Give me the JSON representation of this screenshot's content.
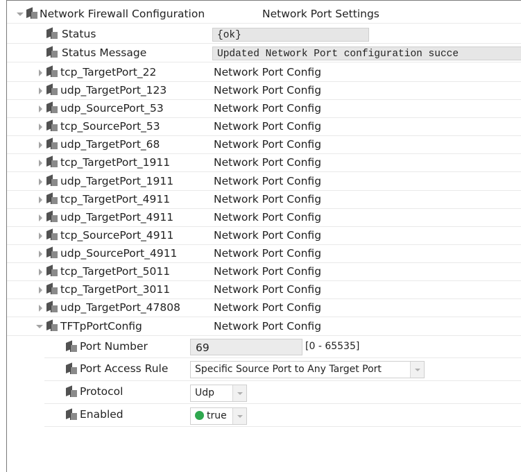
{
  "root": {
    "label": "Network Firewall Configuration",
    "type": "Network Port Settings"
  },
  "status": {
    "label": "Status",
    "value": "{ok}"
  },
  "status_message": {
    "label": "Status Message",
    "value": "Updated Network Port configuration succe"
  },
  "type_label": "Network Port Config",
  "ports": [
    {
      "name": "tcp_TargetPort_22"
    },
    {
      "name": "udp_TargetPort_123"
    },
    {
      "name": "udp_SourcePort_53"
    },
    {
      "name": "tcp_SourcePort_53"
    },
    {
      "name": "udp_TargetPort_68"
    },
    {
      "name": "tcp_TargetPort_1911"
    },
    {
      "name": "udp_TargetPort_1911"
    },
    {
      "name": "tcp_TargetPort_4911"
    },
    {
      "name": "udp_TargetPort_4911"
    },
    {
      "name": "tcp_SourcePort_4911"
    },
    {
      "name": "udp_SourcePort_4911"
    },
    {
      "name": "tcp_TargetPort_5011"
    },
    {
      "name": "tcp_TargetPort_3011"
    },
    {
      "name": "udp_TargetPort_47808"
    }
  ],
  "expanded": {
    "name": "TFTpPortConfig",
    "type": "Network Port Config",
    "port_number": {
      "label": "Port Number",
      "value": "69",
      "range": "[0 - 65535]"
    },
    "access_rule": {
      "label": "Port Access Rule",
      "value": "Specific Source Port to Any Target Port"
    },
    "protocol": {
      "label": "Protocol",
      "value": "Udp"
    },
    "enabled": {
      "label": "Enabled",
      "value": "true",
      "color": "#2fa84f"
    }
  }
}
